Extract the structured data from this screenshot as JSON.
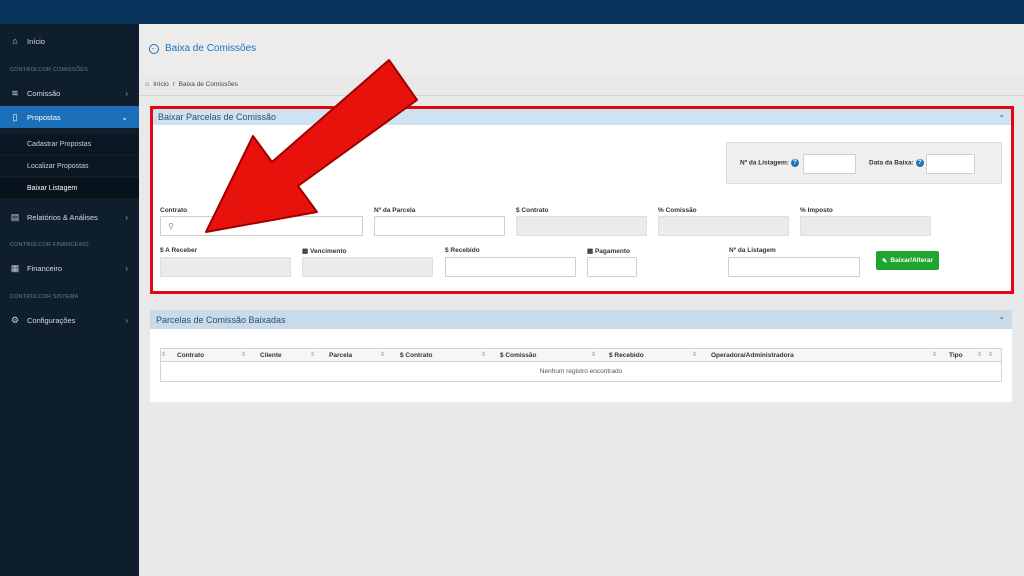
{
  "colors": {
    "accent": "#1e73be",
    "sidebar": "#0f1e2c",
    "topbar": "#08325a",
    "highlight": "#e30613",
    "success": "#21a531"
  },
  "sidebar": {
    "home": {
      "label": "Início",
      "icon": "home-icon"
    },
    "section1": "CONTROLCOR COMISSÕES",
    "comissao": {
      "label": "Comissão",
      "icon": "layers-icon"
    },
    "propostas": {
      "label": "Propostas",
      "icon": "clipboard-icon"
    },
    "sub": [
      {
        "label": "Cadastrar Propostas"
      },
      {
        "label": "Localizar Propostas"
      },
      {
        "label": "Baixar Listagem"
      }
    ],
    "relatorios": {
      "label": "Relatórios & Análises",
      "icon": "report-icon"
    },
    "section2": "CONTROLCOR FINANCEIRO",
    "financeiro": {
      "label": "Financeiro",
      "icon": "calculator-icon"
    },
    "section3": "CONTROLCOR SISTEMA",
    "configuracoes": {
      "label": "Configurações",
      "icon": "gear-icon"
    }
  },
  "header": {
    "title": "Baixa de Comissões",
    "breadcrumb_home": "Início",
    "breadcrumb_sep": "/",
    "breadcrumb_current": "Baixa de Comissões"
  },
  "form_panel": {
    "title": "Baixar Parcelas de Comissão",
    "listagem_label": "Nº da Listagem:",
    "data_baixa_label": "Data da Baixa:",
    "contrato_label": "Contrato",
    "parcela_label": "Nº da Parcela",
    "valor_contrato_label": "$ Contrato",
    "pct_comissao_label": "% Comissão",
    "pct_imposto_label": "% Imposto",
    "a_receber_label": "$ A Receber",
    "vencimento_label": "Vencimento",
    "recebido_label": "$ Recebido",
    "pagamento_label": "Pagamento",
    "listagem2_label": "Nº da Listagem",
    "submit_label": "Baixar/Alterar"
  },
  "table_panel": {
    "title": "Parcelas de Comissão Baixadas",
    "columns": [
      "Contrato",
      "Cliente",
      "Parcela",
      "$ Contrato",
      "$ Comissão",
      "$ Recebido",
      "Operadora/Administradora",
      "Tipo"
    ],
    "empty_text": "Nenhum registro encontrado"
  }
}
